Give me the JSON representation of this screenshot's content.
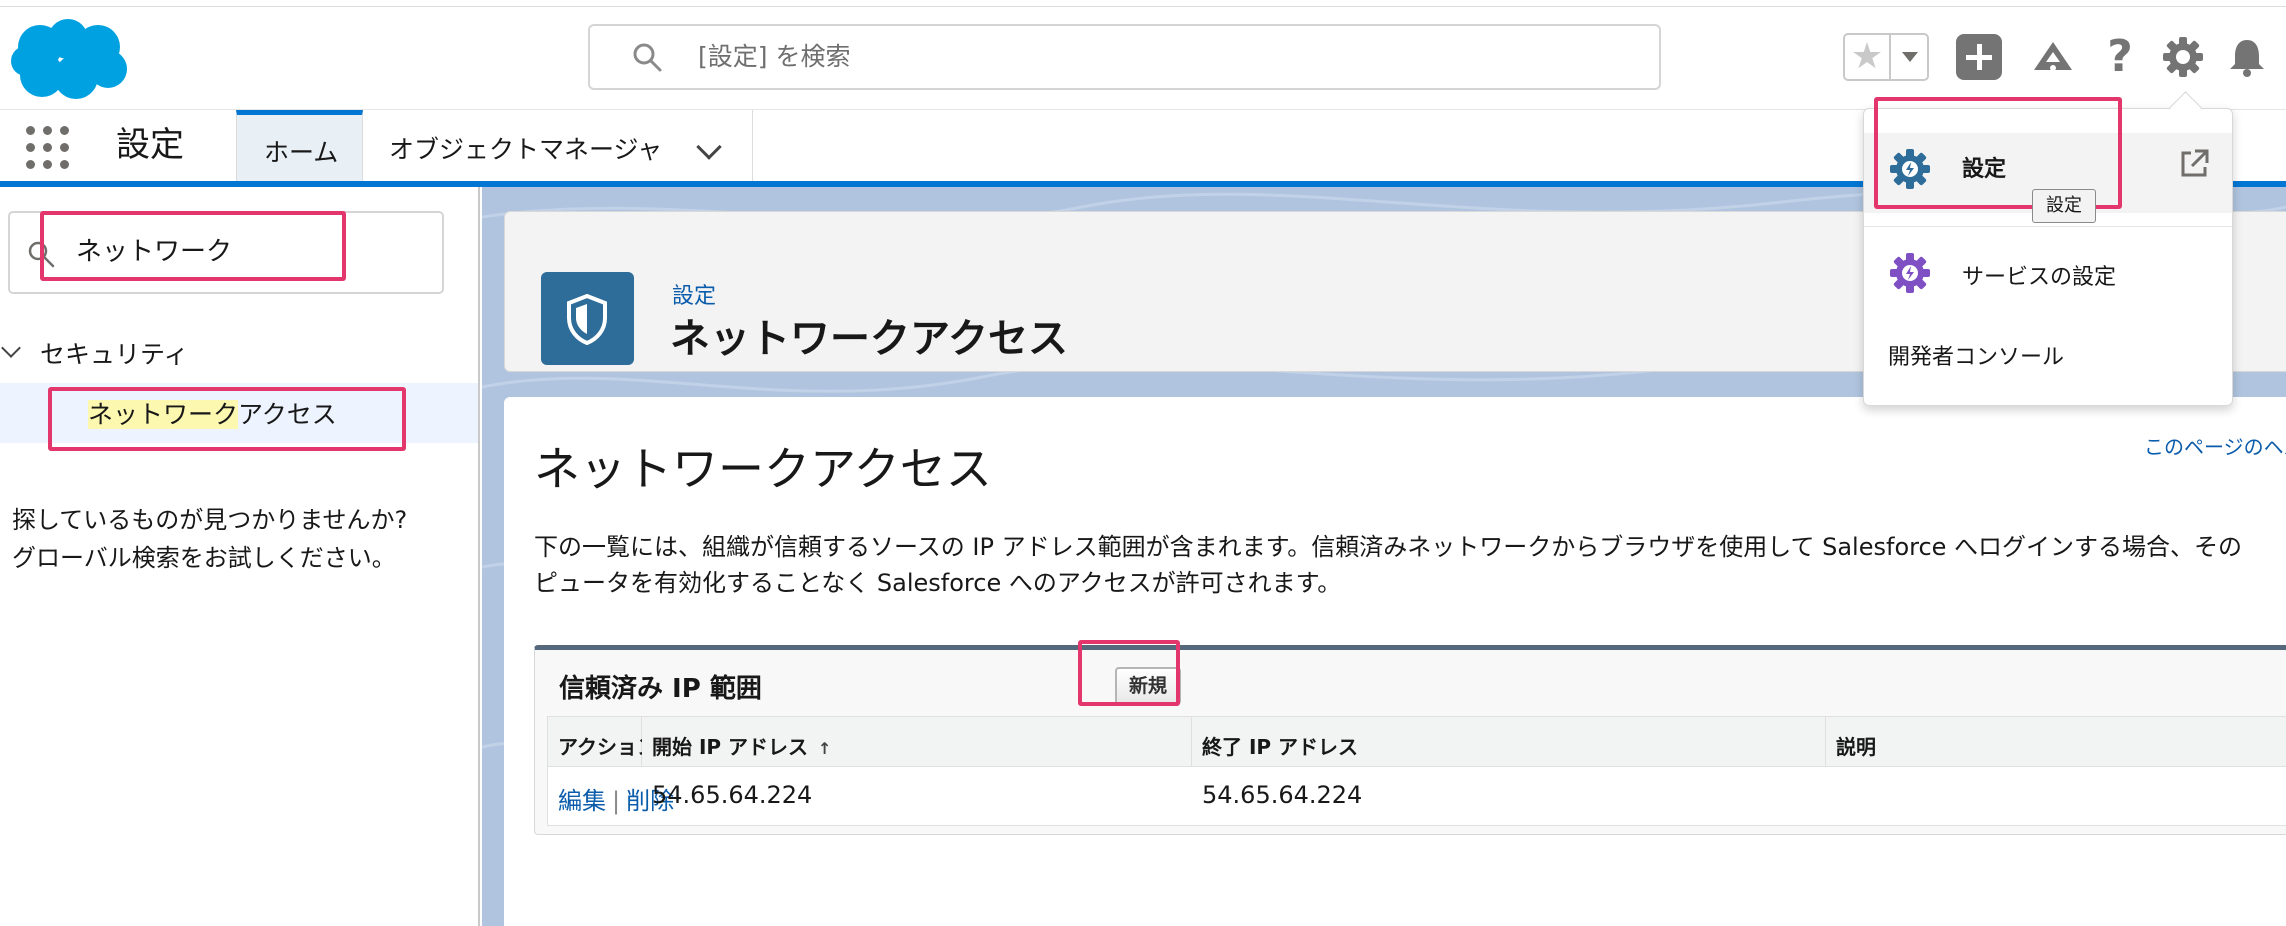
{
  "header": {
    "search_placeholder": "[設定] を検索",
    "help_symbol": "?"
  },
  "nav": {
    "app_name": "設定",
    "tabs": [
      {
        "label": "ホーム"
      },
      {
        "label": "オブジェクトマネージャ"
      }
    ]
  },
  "sidebar": {
    "quick_find_value": "ネットワーク",
    "section_label": "セキュリティ",
    "item_label_highlight": "ネットワーク",
    "item_label_rest": "アクセス",
    "not_found_line1": "探しているものが見つかりませんか?",
    "not_found_line2": "グローバル検索をお試しください。"
  },
  "page_header": {
    "subtitle": "設定",
    "title": "ネットワークアクセス"
  },
  "content": {
    "help_link": "このページのヘル",
    "title": "ネットワークアクセス",
    "description_line1": "下の一覧には、組織が信頼するソースの IP アドレス範囲が含まれます。信頼済みネットワークからブラウザを使用して Salesforce へログインする場合、その",
    "description_line2": "ピュータを有効化することなく Salesforce へのアクセスが許可されます。"
  },
  "ip_ranges": {
    "title": "信頼済み IP 範囲",
    "new_button": "新規",
    "columns": [
      "アクション",
      "開始 IP アドレス",
      "終了 IP アドレス",
      "説明"
    ],
    "sort_symbol": "↑",
    "rows": [
      {
        "edit": "編集",
        "separator": "|",
        "delete": "削除",
        "start_ip": "54.65.64.224",
        "end_ip": "54.65.64.224",
        "description": ""
      }
    ]
  },
  "dropdown": {
    "item1": "設定",
    "tooltip": "設定",
    "item2": "サービスの設定",
    "item3": "開発者コンソール"
  },
  "colors": {
    "accent": "#0176d3",
    "highlight_box": "#e3366d",
    "link": "#0b5cab"
  }
}
